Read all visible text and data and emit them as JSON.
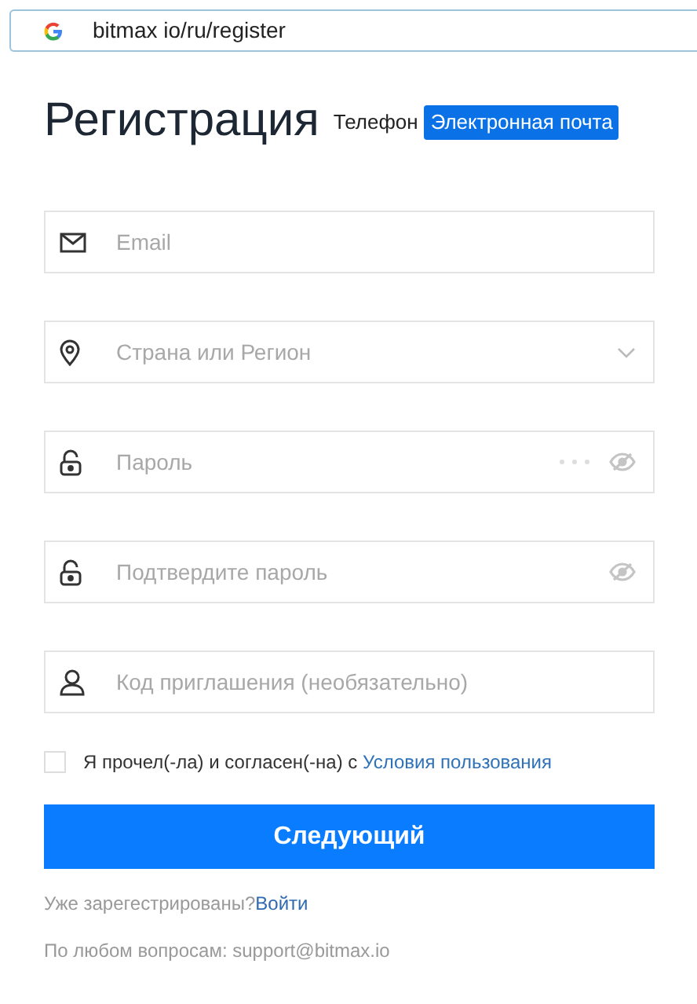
{
  "address_bar": {
    "url": "bitmax io/ru/register"
  },
  "title": "Регистрация",
  "tabs": [
    {
      "label": "Телефон",
      "selected": false
    },
    {
      "label": "Электронная почта",
      "selected": true
    }
  ],
  "fields": [
    {
      "kind": "email",
      "placeholder": "Email"
    },
    {
      "kind": "country",
      "placeholder": "Страна или Регион"
    },
    {
      "kind": "password",
      "placeholder": "Пароль"
    },
    {
      "kind": "confirm",
      "placeholder": "Подтвердите пароль"
    },
    {
      "kind": "invite",
      "placeholder": "Код приглашения (необязательно)"
    }
  ],
  "agreement": {
    "checked": false,
    "text": "Я прочел(-ла) и согласен(-на) с ",
    "link": "Условия пользования"
  },
  "submit": "Следующий",
  "login": {
    "text": "Уже зарегестрированы?",
    "link": "Войти"
  },
  "support": "По любом вопросам: support@bitmax.io"
}
